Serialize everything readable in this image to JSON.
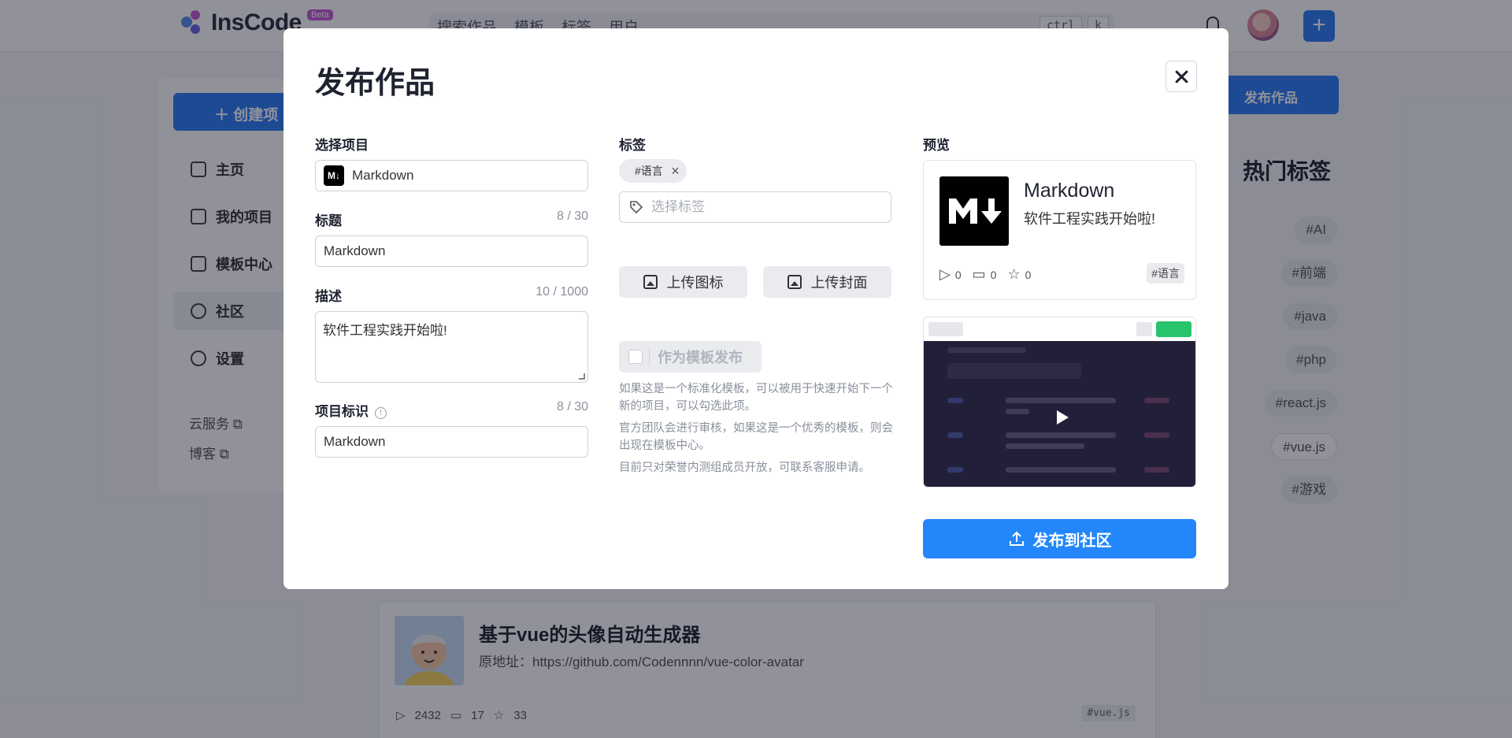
{
  "app": {
    "name": "InsCode",
    "beta_badge": "Beta",
    "search_tabs": [
      "搜索作品",
      "模板",
      "标签",
      "用户"
    ],
    "shortcut_keys": [
      "ctrl",
      "k"
    ]
  },
  "sidebar": {
    "create_button": "创建项",
    "items": [
      {
        "label": "主页",
        "icon": "home-icon"
      },
      {
        "label": "我的项目",
        "icon": "layers-icon"
      },
      {
        "label": "模板中心",
        "icon": "template-icon"
      },
      {
        "label": "社区",
        "icon": "community-icon",
        "active": true
      },
      {
        "label": "设置",
        "icon": "settings-icon"
      }
    ],
    "links": [
      {
        "label": "云服务",
        "icon": "external-link-icon"
      },
      {
        "label": "博客",
        "icon": "external-link-icon"
      }
    ]
  },
  "right_panel": {
    "publish_button": "发布作品",
    "hot_tags_title": "热门标签",
    "hot_tags": [
      "#AI",
      "#前端",
      "#java",
      "#php",
      "#react.js",
      "#vue.js",
      "#游戏"
    ]
  },
  "feed": {
    "title": "基于vue的头像自动生成器",
    "description": "原地址：https://github.com/Codennnn/vue-color-avatar",
    "plays": "2432",
    "comments": "17",
    "stars": "33",
    "tag": "#vue.js"
  },
  "modal": {
    "title": "发布作品",
    "select_project": {
      "label": "选择项目",
      "value": "Markdown",
      "icon": "markdown-icon"
    },
    "title_field": {
      "label": "标题",
      "count": "8 / 30",
      "value": "Markdown"
    },
    "description_field": {
      "label": "描述",
      "count": "10 / 1000",
      "value": "软件工程实践开始啦!"
    },
    "identifier_field": {
      "label": "项目标识",
      "count": "8 / 30",
      "value": "Markdown"
    },
    "tags": {
      "label": "标签",
      "selected": [
        "#语言"
      ],
      "placeholder": "选择标签"
    },
    "upload_icon_button": "上传图标",
    "upload_cover_button": "上传封面",
    "template_checkbox": "作为模板发布",
    "template_hints": [
      "如果这是一个标准化模板，可以被用于快速开始下一个新的项目，可以勾选此项。",
      "官方团队会进行审核，如果这是一个优秀的模板，则会出现在模板中心。",
      "目前只对荣誉内测组成员开放，可联系客服申请。"
    ],
    "preview": {
      "label": "预览",
      "name": "Markdown",
      "description": "软件工程实践开始啦!",
      "plays": "0",
      "comments": "0",
      "stars": "0",
      "tag": "#语言"
    },
    "publish_button": "发布到社区"
  },
  "colors": {
    "primary": "#2f7df6",
    "publish": "#2387fb",
    "overlay": "rgba(10,14,28,0.45)"
  }
}
